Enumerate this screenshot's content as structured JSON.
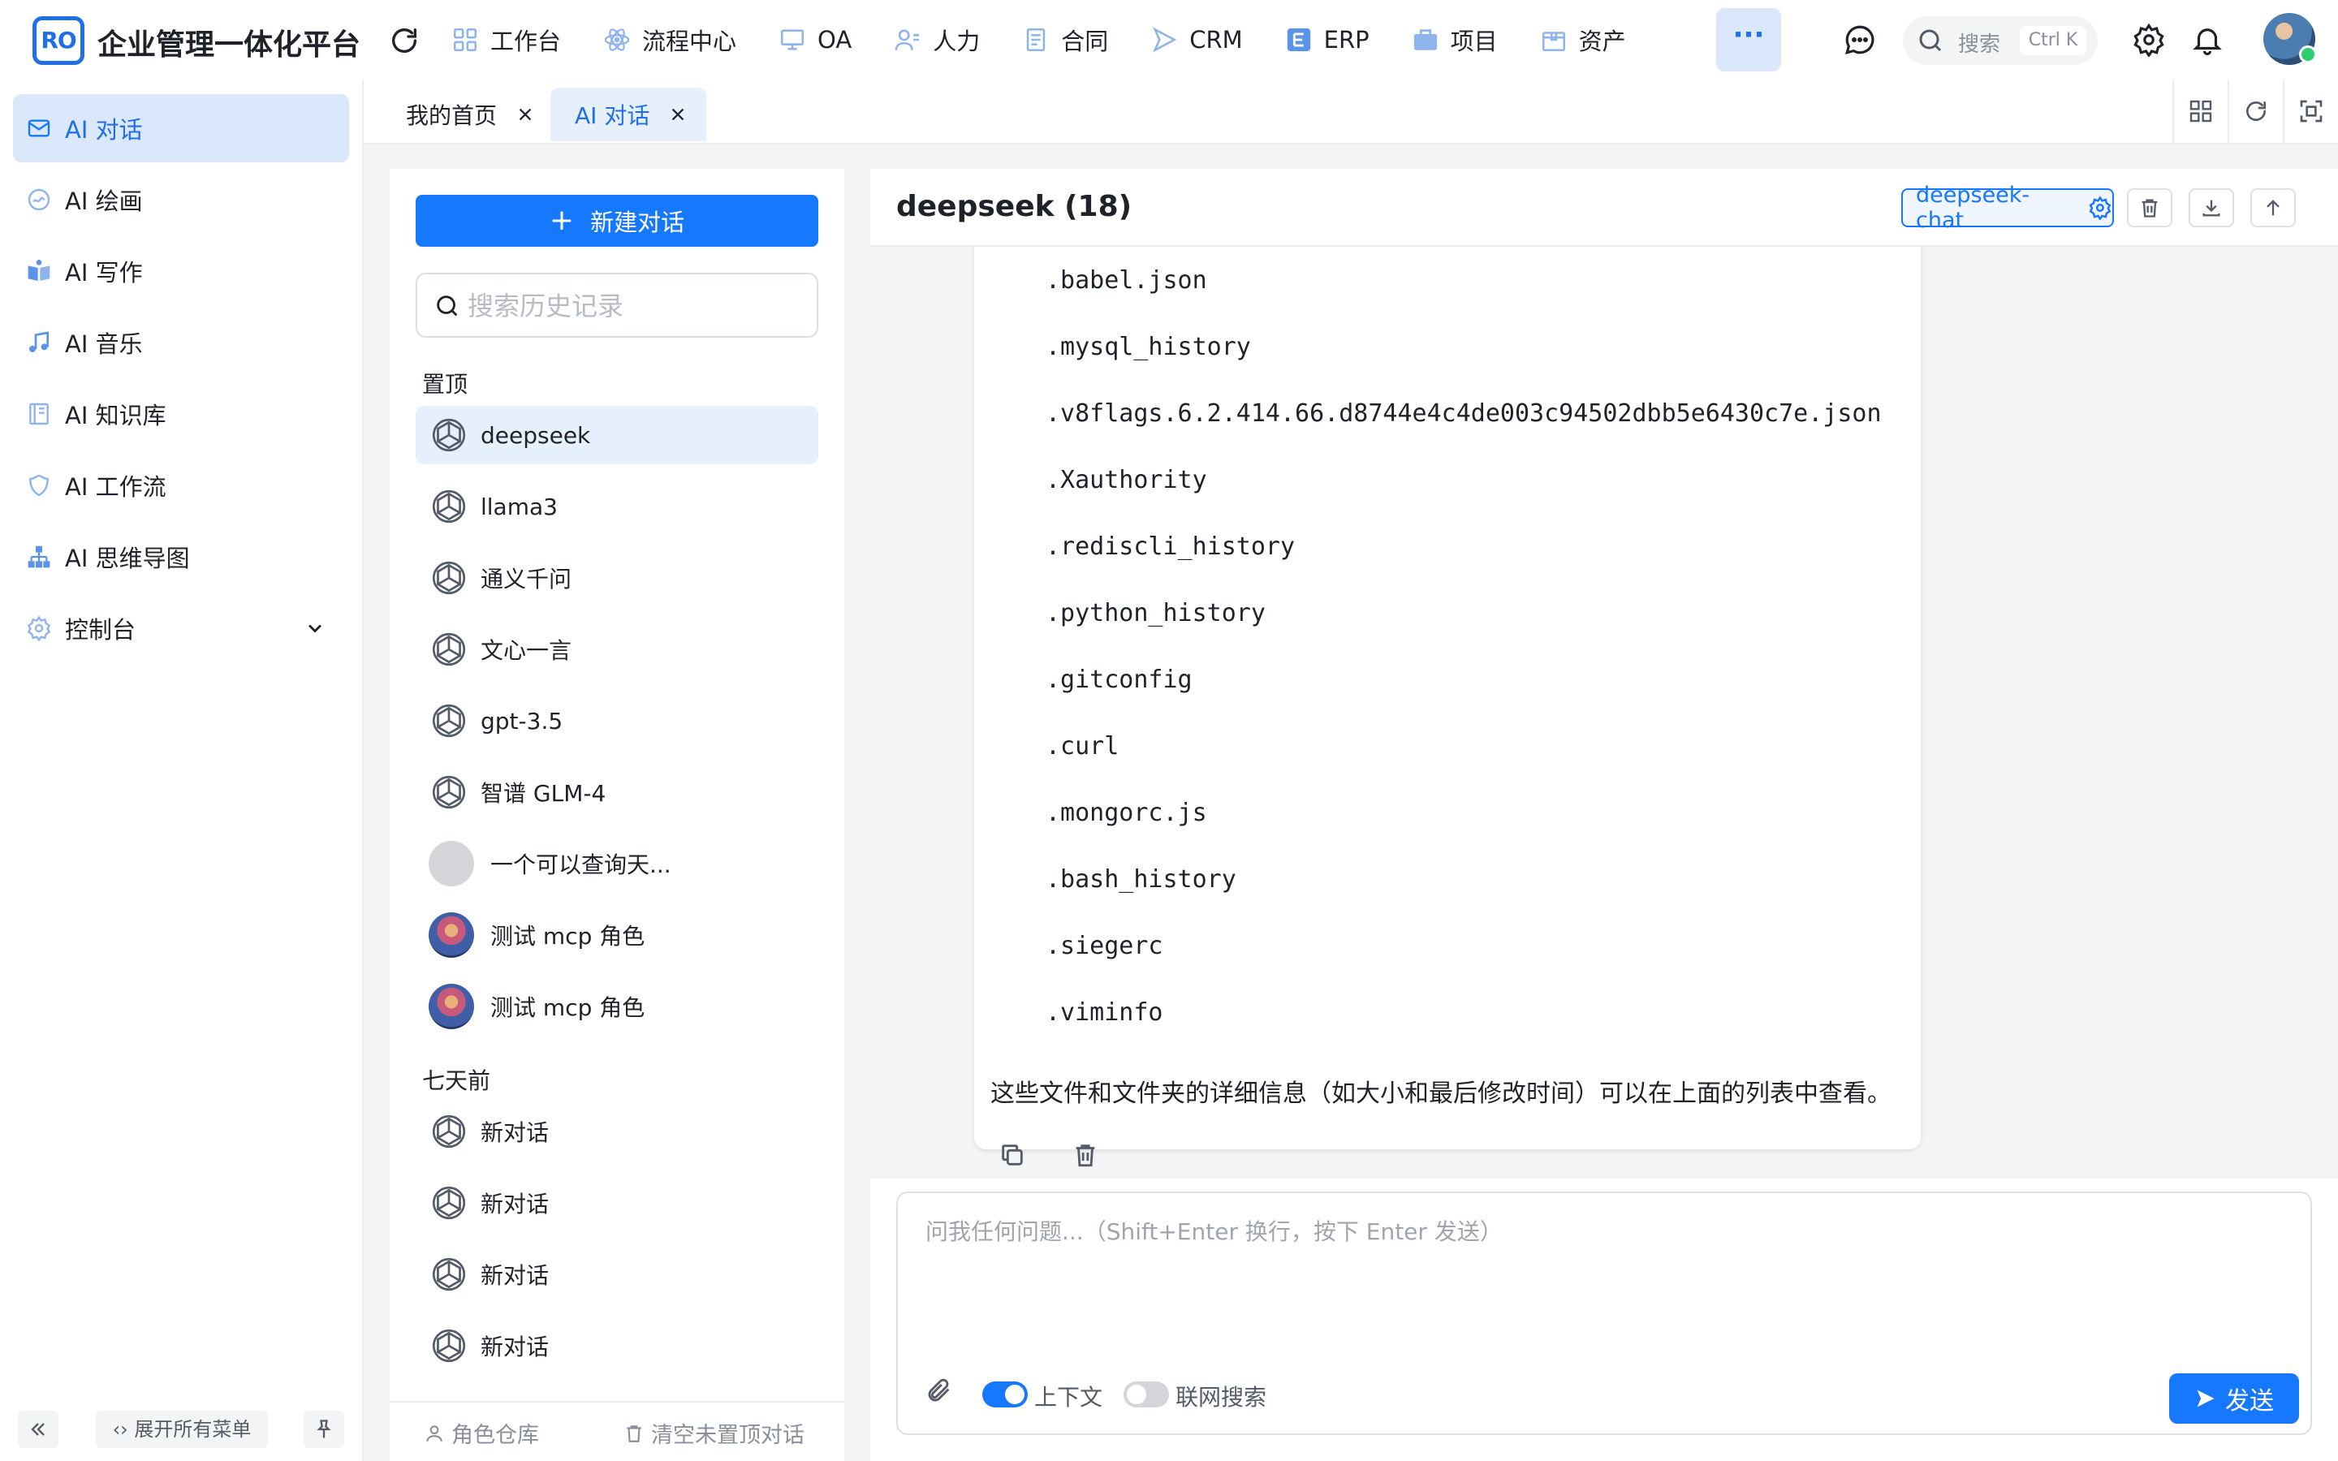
{
  "colors": {
    "accent": "#1677ff",
    "active_bg": "#dbe8fb",
    "success": "#2ecc71"
  },
  "header": {
    "logo_text": "RO",
    "title": "企业管理一体化平台",
    "nav": [
      {
        "label": "工作台",
        "icon": "grid-icon"
      },
      {
        "label": "流程中心",
        "icon": "atom-icon"
      },
      {
        "label": "OA",
        "icon": "monitor-icon"
      },
      {
        "label": "人力",
        "icon": "user-list-icon"
      },
      {
        "label": "合同",
        "icon": "document-icon"
      },
      {
        "label": "CRM",
        "icon": "send-icon"
      },
      {
        "label": "ERP",
        "icon": "erp-icon"
      },
      {
        "label": "项目",
        "icon": "briefcase-icon"
      },
      {
        "label": "资产",
        "icon": "box-icon"
      }
    ],
    "more": "···",
    "search": {
      "placeholder": "搜索",
      "shortcut": "Ctrl K"
    }
  },
  "sidebar": {
    "items": [
      {
        "label": "AI 对话",
        "icon": "chat-icon",
        "active": true
      },
      {
        "label": "AI 绘画",
        "icon": "palette-icon"
      },
      {
        "label": "AI 写作",
        "icon": "book-icon"
      },
      {
        "label": "AI 音乐",
        "icon": "music-icon"
      },
      {
        "label": "AI 知识库",
        "icon": "library-icon"
      },
      {
        "label": "AI 工作流",
        "icon": "shield-icon"
      },
      {
        "label": "AI 思维导图",
        "icon": "sitemap-icon"
      },
      {
        "label": "控制台",
        "icon": "gear-icon"
      }
    ],
    "expand_all": "‹› 展开所有菜单"
  },
  "tabs": [
    {
      "label": "我的首页"
    },
    {
      "label": "AI 对话",
      "active": true
    }
  ],
  "conversations": {
    "new_chat": "新建对话",
    "search_placeholder": "搜索历史记录",
    "pinned_label": "置顶",
    "pinned": [
      "deepseek",
      "llama3",
      "通义千问",
      "文心一言",
      "gpt-3.5",
      "智谱 GLM-4",
      "一个可以查询天...",
      "测试 mcp 角色",
      "测试 mcp 角色"
    ],
    "week_label": "七天前",
    "week": [
      "新对话",
      "新对话",
      "新对话",
      "新对话"
    ],
    "role_repo": "角色仓库",
    "clear_unpinned": "清空未置顶对话"
  },
  "chat": {
    "title": "deepseek (18)",
    "model": "deepseek-chat",
    "code_lines": [
      ".babel.json",
      ".mysql_history",
      ".v8flags.6.2.414.66.d8744e4c4de003c94502dbb5e6430c7e.json",
      ".Xauthority",
      ".rediscli_history",
      ".python_history",
      ".gitconfig",
      ".curl",
      ".mongorc.js",
      ".bash_history",
      ".siegerc",
      ".viminfo"
    ],
    "answer_text": "这些文件和文件夹的详细信息（如大小和最后修改时间）可以在上面的列表中查看。",
    "input_placeholder": "问我任何问题...（Shift+Enter 换行，按下 Enter 发送）",
    "context_label": "上下文",
    "context_on": true,
    "web_search_label": "联网搜索",
    "web_search_on": false,
    "send": "发送"
  }
}
